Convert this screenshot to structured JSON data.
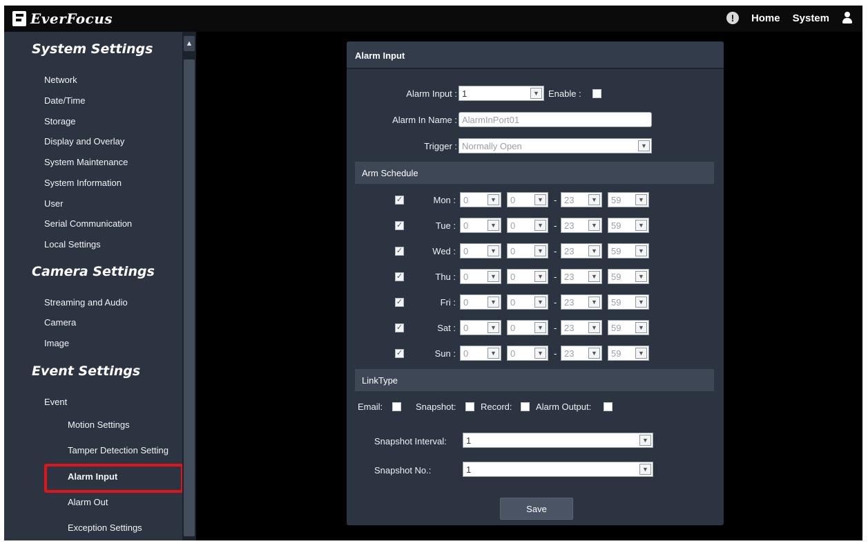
{
  "header": {
    "brand": "EverFocus",
    "nav": {
      "alert": "!",
      "home": "Home",
      "system": "System"
    }
  },
  "sidebar": {
    "system_settings": {
      "title": "System Settings",
      "items": [
        "Network",
        "Date/Time",
        "Storage",
        "Display and Overlay",
        "System Maintenance",
        "System Information",
        "User",
        "Serial Communication",
        "Local Settings"
      ]
    },
    "camera_settings": {
      "title": "Camera Settings",
      "items": [
        "Streaming and Audio",
        "Camera",
        "Image"
      ]
    },
    "event_settings": {
      "title": "Event Settings",
      "event": "Event",
      "sub_items": [
        "Motion Settings",
        "Tamper Detection Setting",
        "Alarm Input",
        "Alarm Out",
        "Exception Settings"
      ],
      "active": "Alarm Input"
    }
  },
  "panel": {
    "title": "Alarm Input",
    "alarm_input_label": "Alarm Input :",
    "alarm_input_value": "1",
    "enable_label": "Enable :",
    "enable_checked": false,
    "name_label": "Alarm In Name :",
    "name_value": "AlarmInPort01",
    "trigger_label": "Trigger :",
    "trigger_value": "Normally Open",
    "arm_schedule": {
      "title": "Arm Schedule",
      "days": [
        {
          "label": "Mon :",
          "checked": true,
          "start_h": "0",
          "start_m": "0",
          "end_h": "23",
          "end_m": "59"
        },
        {
          "label": "Tue :",
          "checked": true,
          "start_h": "0",
          "start_m": "0",
          "end_h": "23",
          "end_m": "59"
        },
        {
          "label": "Wed :",
          "checked": true,
          "start_h": "0",
          "start_m": "0",
          "end_h": "23",
          "end_m": "59"
        },
        {
          "label": "Thu :",
          "checked": true,
          "start_h": "0",
          "start_m": "0",
          "end_h": "23",
          "end_m": "59"
        },
        {
          "label": "Fri :",
          "checked": true,
          "start_h": "0",
          "start_m": "0",
          "end_h": "23",
          "end_m": "59"
        },
        {
          "label": "Sat :",
          "checked": true,
          "start_h": "0",
          "start_m": "0",
          "end_h": "23",
          "end_m": "59"
        },
        {
          "label": "Sun :",
          "checked": true,
          "start_h": "0",
          "start_m": "0",
          "end_h": "23",
          "end_m": "59"
        }
      ],
      "separator": "-"
    },
    "link_type": {
      "title": "LinkType",
      "email_label": "Email:",
      "snapshot_label": "Snapshot:",
      "record_label": "Record:",
      "alarm_output_label": "Alarm Output:",
      "snapshot_interval_label": "Snapshot Interval:",
      "snapshot_interval_value": "1",
      "snapshot_no_label": "Snapshot No.:",
      "snapshot_no_value": "1"
    },
    "save_label": "Save"
  },
  "colors": {
    "sidebar_bg": "#2c3442",
    "panel_bg": "#2c3442",
    "band_bg": "#3e4756",
    "highlight": "#e0141b",
    "topbar_bg": "#0b0b0b"
  }
}
